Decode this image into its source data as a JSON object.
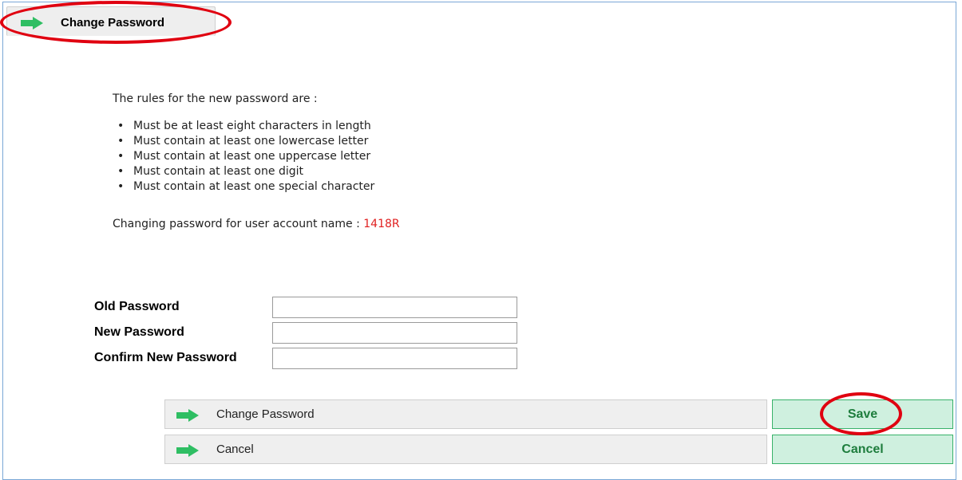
{
  "header": {
    "tab_title": "Change Password"
  },
  "intro": "The rules for the new password are :",
  "rules": [
    "Must be at least eight characters in length",
    "Must contain at least one lowercase letter",
    "Must contain at least one uppercase letter",
    "Must contain at least one digit",
    "Must contain at least one special character"
  ],
  "account": {
    "label": "Changing password for user account name :",
    "name": "1418R"
  },
  "form": {
    "old_password": {
      "label": "Old Password",
      "value": ""
    },
    "new_password": {
      "label": "New Password",
      "value": ""
    },
    "confirm_password": {
      "label": "Confirm New Password",
      "value": ""
    }
  },
  "actions": {
    "change_label": "Change Password",
    "cancel_label": "Cancel",
    "save_button": "Save",
    "cancel_button": "Cancel"
  },
  "icons": {
    "arrow": "right-arrow-icon"
  },
  "colors": {
    "accent_green": "#2fbe63",
    "account_name": "#e02020",
    "highlight_oval": "#e00010",
    "button_bg": "#cff0df",
    "button_text": "#1e7d3d"
  }
}
